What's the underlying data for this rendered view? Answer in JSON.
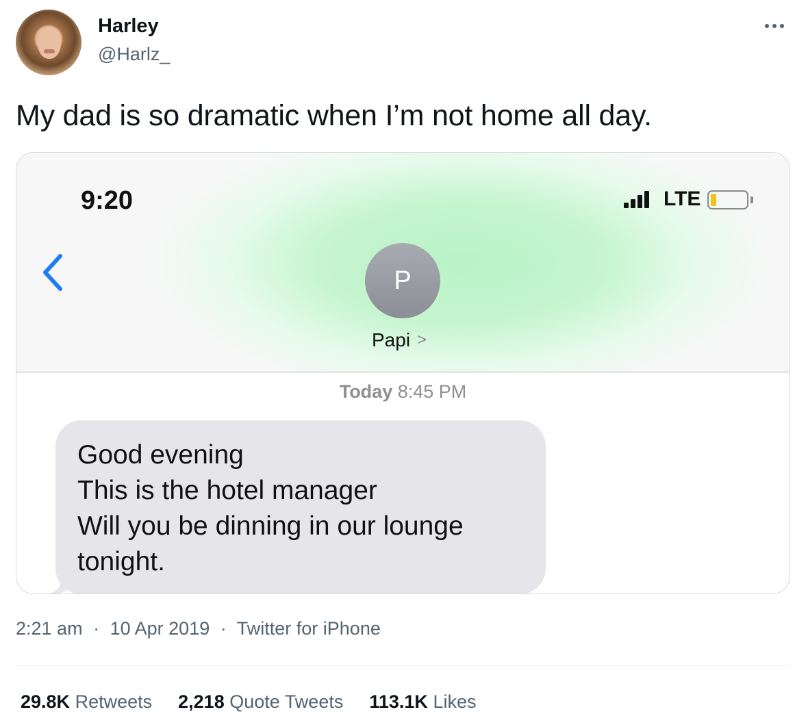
{
  "author": {
    "display_name": "Harley",
    "handle": "@Harlz_"
  },
  "tweet": {
    "text": "My dad is so dramatic when I’m not home all day."
  },
  "screenshot": {
    "status_time": "9:20",
    "network": "LTE",
    "contact_initial": "P",
    "contact_name": "Papi",
    "chevron": ">",
    "day_label": "Today",
    "time_label": "8:45 PM",
    "message_lines": [
      "Good evening",
      "This is the hotel manager",
      "Will you be dinning in our lounge",
      "tonight."
    ],
    "battery_color": "#f3c31b",
    "back_color": "#1f7cf2"
  },
  "meta": {
    "time": "2:21 am",
    "date": "10 Apr 2019",
    "source": "Twitter for iPhone",
    "separator": "·"
  },
  "stats": {
    "retweets_count": "29.8K",
    "retweets_label": "Retweets",
    "quotes_count": "2,218",
    "quotes_label": "Quote Tweets",
    "likes_count": "113.1K",
    "likes_label": "Likes"
  },
  "icons": {
    "more": "more-horizontal-icon",
    "back": "chevron-left-icon"
  }
}
